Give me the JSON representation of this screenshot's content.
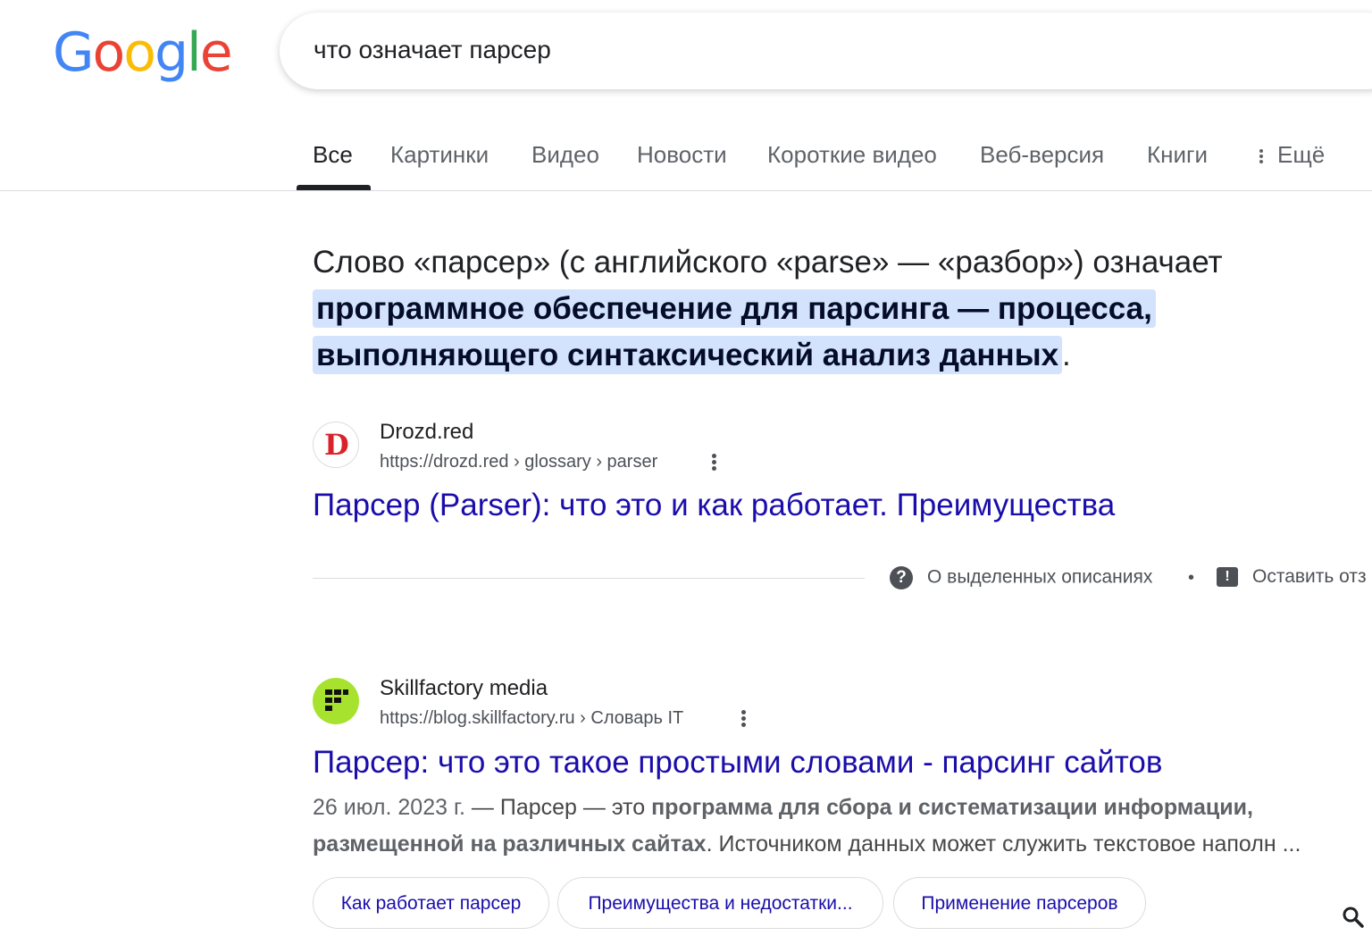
{
  "header": {
    "logo": [
      "G",
      "o",
      "o",
      "g",
      "l",
      "e"
    ],
    "logo_colors": [
      "#4285F4",
      "#EA4335",
      "#FBBC05",
      "#4285F4",
      "#34A853",
      "#EA4335"
    ],
    "search_query": "что означает парсер"
  },
  "tabs": [
    {
      "label": "Все",
      "active": true
    },
    {
      "label": "Картинки",
      "active": false
    },
    {
      "label": "Видео",
      "active": false
    },
    {
      "label": "Новости",
      "active": false
    },
    {
      "label": "Короткие видео",
      "active": false
    },
    {
      "label": "Веб-версия",
      "active": false
    },
    {
      "label": "Книги",
      "active": false
    },
    {
      "label": "Ещё",
      "active": false
    }
  ],
  "featured_snippet": {
    "text_before": "Слово «парсер» (с английского «parse» — «разбор») означает ",
    "highlight": "программное обеспечение для парсинга — процесса, выполняющего синтаксический анализ данных",
    "text_after": ".",
    "source": {
      "favicon_letter": "D",
      "site_name": "Drozd.red",
      "url": "https://drozd.red › glossary › parser",
      "title": "Парсер (Parser): что это и как работает. Преимущества"
    },
    "about_label": "О выделенных описаниях",
    "separator": "•",
    "feedback_label": "Оставить отз"
  },
  "results": [
    {
      "site_name": "Skillfactory media",
      "url": "https://blog.skillfactory.ru › Словарь IT",
      "title": "Парсер: что это такое простыми словами - парсинг сайтов",
      "snippet": {
        "date": "26 июл. 2023 г.",
        "dash": " — Парсер — это ",
        "bold": "программа для сбора и систематизации информации, размещенной на различных сайтах",
        "rest": ". Источником данных может служить текстовое наполн ..."
      },
      "chips": [
        "Как работает парсер",
        "Преимущества и недостатки...",
        "Применение парсеров"
      ]
    }
  ],
  "colors": {
    "link": "#1a0dab",
    "highlight_bg": "#d3e3fd",
    "skillfactory_green": "#a6e22e"
  }
}
